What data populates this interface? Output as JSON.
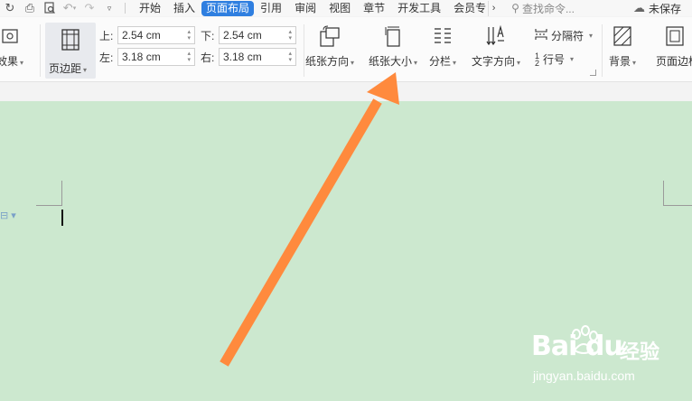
{
  "quick_access": {
    "icons": [
      "redo-icon",
      "print-icon",
      "print-preview-icon",
      "undo-icon",
      "redo-disabled-icon",
      "customize-icon"
    ]
  },
  "tabs": [
    {
      "label": "开始",
      "active": false
    },
    {
      "label": "插入",
      "active": false
    },
    {
      "label": "页面布局",
      "active": true
    },
    {
      "label": "引用",
      "active": false
    },
    {
      "label": "审阅",
      "active": false
    },
    {
      "label": "视图",
      "active": false
    },
    {
      "label": "章节",
      "active": false
    },
    {
      "label": "开发工具",
      "active": false
    },
    {
      "label": "会员专",
      "active": false
    }
  ],
  "search": {
    "placeholder": "查找命令..."
  },
  "save_status": "未保存",
  "ribbon": {
    "effects_label": "效果",
    "margins_label": "页边距",
    "margin_fields": {
      "top": {
        "label": "上:",
        "value": "2.54 cm"
      },
      "bottom": {
        "label": "下:",
        "value": "2.54 cm"
      },
      "left": {
        "label": "左:",
        "value": "3.18 cm"
      },
      "right": {
        "label": "右:",
        "value": "3.18 cm"
      }
    },
    "orientation_label": "纸张方向",
    "size_label": "纸张大小",
    "columns_label": "分栏",
    "text_direction_label": "文字方向",
    "separator_label": "分隔符",
    "line_number_label": "行号",
    "background_label": "背景",
    "page_border_label": "页面边框"
  },
  "watermark": {
    "brand": "Bai du",
    "cn": "经验",
    "url": "jingyan.baidu.com"
  },
  "colors": {
    "accent": "#2f7fe0",
    "canvas": "#cce8cf",
    "arrow": "#ff8a3d"
  }
}
